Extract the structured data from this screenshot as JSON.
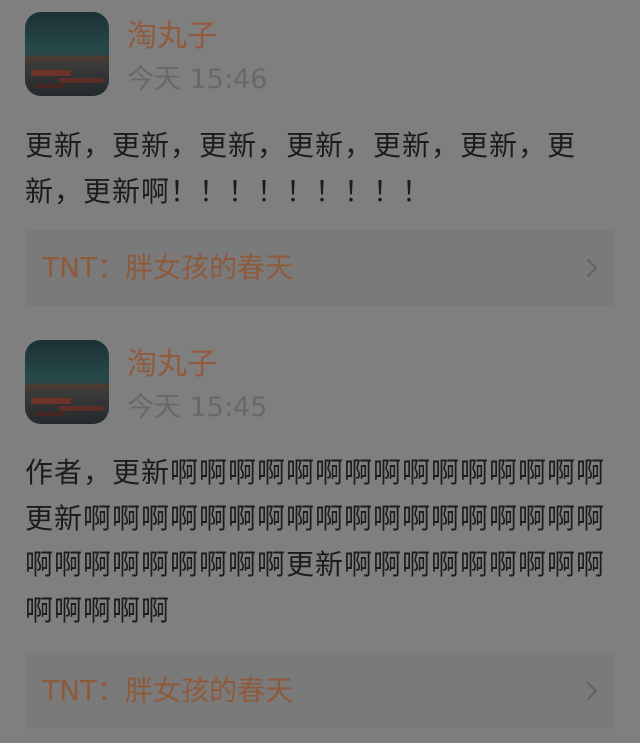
{
  "posts": [
    {
      "username": "淘丸子",
      "timestamp": "今天 15:46",
      "text": "更新，更新，更新，更新，更新，更新，更新，更新啊！！！！！！！！！",
      "link": {
        "title": "TNT：胖女孩的春天",
        "icon": "chevron-right-icon"
      }
    },
    {
      "username": "淘丸子",
      "timestamp": "今天 15:45",
      "text": "作者，更新啊啊啊啊啊啊啊啊啊啊啊啊啊啊啊更新啊啊啊啊啊啊啊啊啊啊啊啊啊啊啊啊啊啊啊啊啊啊啊啊啊啊啊更新啊啊啊啊啊啊啊啊啊啊啊啊啊啊",
      "link": {
        "title": "TNT：胖女孩的春天",
        "icon": "chevron-right-icon"
      }
    }
  ],
  "colors": {
    "background": "#7f7f7f",
    "card_background": "#7a7a7a",
    "username": "#905a3e",
    "link_title": "#8f5a3c",
    "timestamp": "#686868",
    "body_text": "#1c1c1c"
  }
}
